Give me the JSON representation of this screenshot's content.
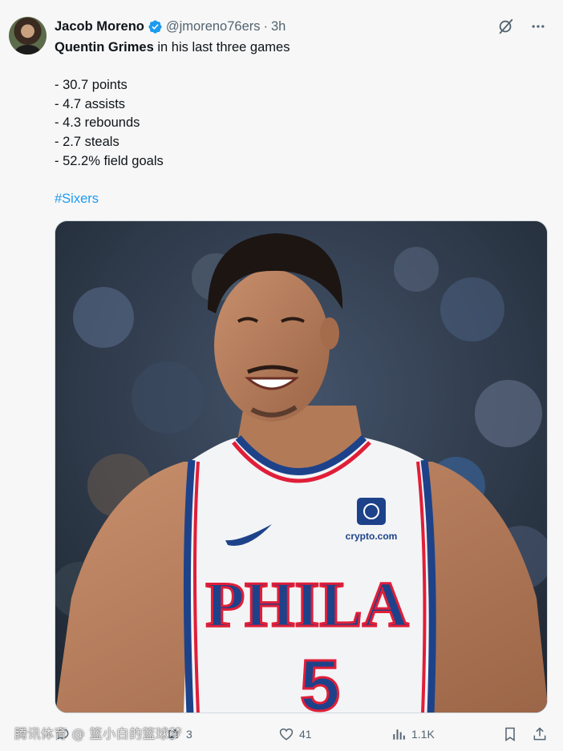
{
  "author": {
    "name": "Jacob Moreno",
    "handle": "@jmoreno76ers",
    "separator": "·",
    "time": "3h"
  },
  "post": {
    "lead_bold": "Quentin Grimes",
    "lead_rest": " in his last three games",
    "stats": [
      "- 30.7 points",
      "- 4.7 assists",
      "- 4.3 rebounds",
      "- 2.7 steals",
      "- 52.2% field goals"
    ],
    "hashtag": "#Sixers"
  },
  "media": {
    "jersey_word": "PHILA",
    "jersey_number": "5",
    "sponsor": "crypto.com"
  },
  "actions": {
    "reply_count": "",
    "repost_count": "3",
    "like_count": "41",
    "views_count": "1.1K"
  },
  "watermark": "腾讯体育 @ 篮小白的篮球梦",
  "colors": {
    "accent": "#1d9bf0",
    "secondary_text": "#536471",
    "sixers_blue": "#1d428a",
    "sixers_red": "#e01e38"
  },
  "icons": [
    "verified-badge-icon",
    "grok-icon",
    "more-icon",
    "reply-icon",
    "repost-icon",
    "like-icon",
    "views-icon",
    "bookmark-icon",
    "share-icon"
  ]
}
